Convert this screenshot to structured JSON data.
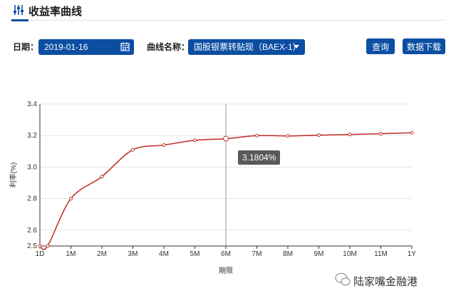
{
  "header": {
    "title": "收益率曲线",
    "icon": "chart-settings-icon"
  },
  "controls": {
    "date_label": "日期：",
    "date_value": "2019-01-16",
    "curve_label": "曲线名称：",
    "curve_value": "国股银票转贴现（BAEX-1）",
    "query_button": "查询",
    "download_button": "数据下载"
  },
  "tooltip": {
    "text": "3.1804%"
  },
  "watermark": {
    "text": "陆家嘴金融港"
  },
  "chart_data": {
    "type": "line",
    "categories": [
      "1D",
      "1M",
      "2M",
      "3M",
      "4M",
      "5M",
      "6M",
      "7M",
      "8M",
      "9M",
      "10M",
      "11M",
      "1Y"
    ],
    "series": [
      {
        "values": [
          2.5,
          2.5,
          2.8,
          2.94,
          3.11,
          3.14,
          3.17,
          3.1804,
          3.2,
          3.198,
          3.203,
          3.207,
          3.212,
          3.218
        ],
        "x_index": [
          0,
          0.25,
          1,
          2,
          3,
          4,
          5,
          6,
          7,
          8,
          9,
          10,
          11,
          12
        ],
        "color": "#c23531"
      }
    ],
    "xlabel": "期限",
    "ylabel": "利率(%)",
    "yticks": [
      "2.5",
      "2.6",
      "2.8",
      "3.0",
      "3.2",
      "3.4"
    ],
    "ylim": [
      2.5,
      3.4
    ],
    "highlight": {
      "category": "6M",
      "value": 3.1804
    },
    "grid": true
  }
}
